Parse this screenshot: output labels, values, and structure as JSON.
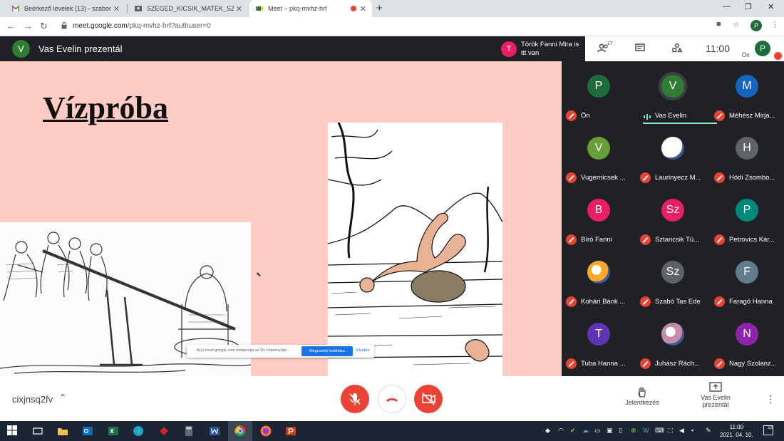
{
  "tabs": [
    {
      "label": "Beérkező levelek (13) - szabone...",
      "icon": "gmail-icon"
    },
    {
      "label": "SZEGED_KICSIK_MATEK_SZ3_2021",
      "icon": "classroom-icon"
    },
    {
      "label": "Meet – pkq-mvhz-hrf",
      "icon": "meet-icon",
      "active": true,
      "recording": true
    }
  ],
  "address": {
    "url_host": "meet.google.com",
    "url_path": "/pkq-mvhz-hrf?authuser=0"
  },
  "browser_profile": "P",
  "meet_header": {
    "presenter_initial": "V",
    "presenter_title": "Vas Evelin prezentál",
    "join_notice": {
      "initial": "T",
      "text": "Török Fanni Mira is itt van"
    },
    "people_count": "17",
    "clock": "11:00",
    "you_label": "Ön",
    "you_initial": "P"
  },
  "slide": {
    "title": "Vízpróba",
    "share_notice": {
      "text": "A(z) meet.google.com megosztja az Ön képernyőjét.",
      "stop_label": "Megosztás leállítása",
      "hide_label": "Elrejtés"
    }
  },
  "participants": [
    {
      "initial": "P",
      "name": "Ön",
      "color": "#1e6b3c"
    },
    {
      "initial": "V",
      "name": "Vas Evelin",
      "color": "#2e7d32",
      "speaking": true
    },
    {
      "initial": "M",
      "name": "Méhész Mirja...",
      "color": "#1565c0"
    },
    {
      "initial": "V",
      "name": "Vugernicsek ...",
      "color": "#689f38"
    },
    {
      "initial": "",
      "name": "Laurinyecz M...",
      "color": "#ffffff",
      "photo": true
    },
    {
      "initial": "H",
      "name": "Hódi Zsombo...",
      "color": "#5f6368"
    },
    {
      "initial": "B",
      "name": "Bíró Fanni",
      "color": "#e91e63"
    },
    {
      "initial": "Sz",
      "name": "Sztancsik Tü...",
      "color": "#e91e63"
    },
    {
      "initial": "P",
      "name": "Petrovics Kár...",
      "color": "#00897b"
    },
    {
      "initial": "",
      "name": "Kohári Bánk ...",
      "color": "#f9a825",
      "photo": true
    },
    {
      "initial": "Sz",
      "name": "Szabó Tas Ede",
      "color": "#5f6368"
    },
    {
      "initial": "F",
      "name": "Faragó Hanna",
      "color": "#607d8b"
    },
    {
      "initial": "T",
      "name": "Tuba Hanna ...",
      "color": "#5e35b1"
    },
    {
      "initial": "",
      "name": "Juhász Rách...",
      "color": "#c48ca6",
      "photo": true
    },
    {
      "initial": "N",
      "name": "Nagy Szolanz...",
      "color": "#8e24aa"
    }
  ],
  "bottom": {
    "meeting_code": "cixjnsq2fv",
    "raise_hand_label": "Jelentkezés",
    "present_label_1": "Vas Evelin",
    "present_label_2": "prezentál"
  },
  "taskbar": {
    "time": "11:00",
    "date": "2021. 04. 10.",
    "notifications": "13"
  }
}
